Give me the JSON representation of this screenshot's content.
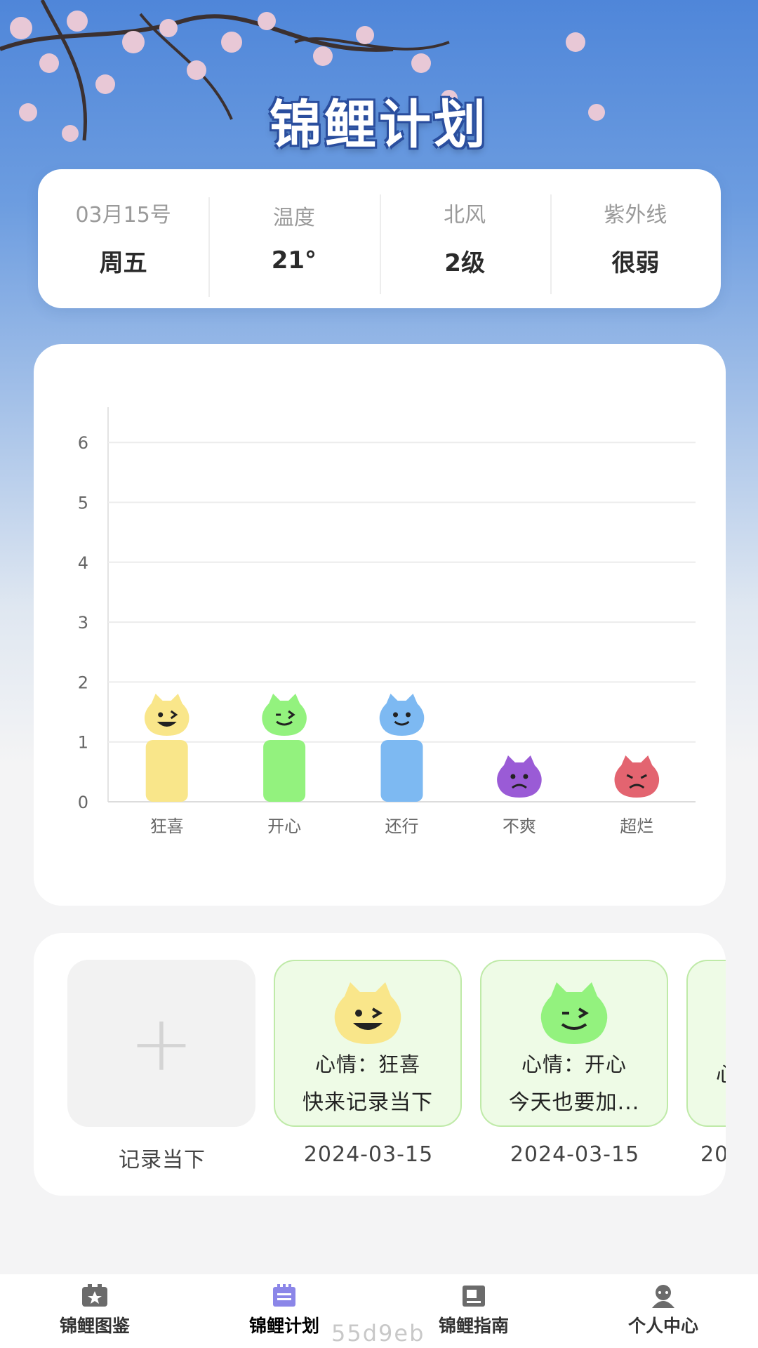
{
  "app": {
    "title": "锦鲤计划"
  },
  "weather": [
    {
      "label": "03月15号",
      "value": "周五"
    },
    {
      "label": "温度",
      "value": "21°"
    },
    {
      "label": "北风",
      "value": "2级"
    },
    {
      "label": "紫外线",
      "value": "很弱"
    }
  ],
  "chart_data": {
    "type": "bar",
    "categories": [
      "狂喜",
      "开心",
      "还行",
      "不爽",
      "超烂"
    ],
    "values": [
      1,
      1,
      1,
      0,
      0
    ],
    "ylim": [
      0,
      6
    ],
    "yticks": [
      "0",
      "1",
      "2",
      "3",
      "4",
      "5",
      "6"
    ],
    "grid": true,
    "colors": [
      "#f9e68a",
      "#93f27e",
      "#7db9f2",
      "#9a5bd6",
      "#e36470"
    ],
    "face_icons": [
      "ecstatic-face-icon",
      "happy-face-icon",
      "okay-face-icon",
      "annoyed-face-icon",
      "awful-face-icon"
    ]
  },
  "records": {
    "add": {
      "caption": "记录当下"
    },
    "items": [
      {
        "mood_line": "心情：狂喜",
        "note": "快来记录当下",
        "date": "2024-03-15",
        "face_color": "#f9e68a"
      },
      {
        "mood_line": "心情：开心",
        "note": "今天也要加...",
        "date": "2024-03-15",
        "face_color": "#93f27e"
      },
      {
        "mood_line": "心",
        "note": "",
        "date": "20",
        "face_color": "#93f27e"
      }
    ]
  },
  "tabs": [
    {
      "label": "锦鲤图鉴",
      "icon": "star-card-icon"
    },
    {
      "label": "锦鲤计划",
      "icon": "notepad-icon",
      "active": true
    },
    {
      "label": "锦鲤指南",
      "icon": "guide-book-icon"
    },
    {
      "label": "个人中心",
      "icon": "user-icon"
    }
  ],
  "watermark": "55d9eb"
}
